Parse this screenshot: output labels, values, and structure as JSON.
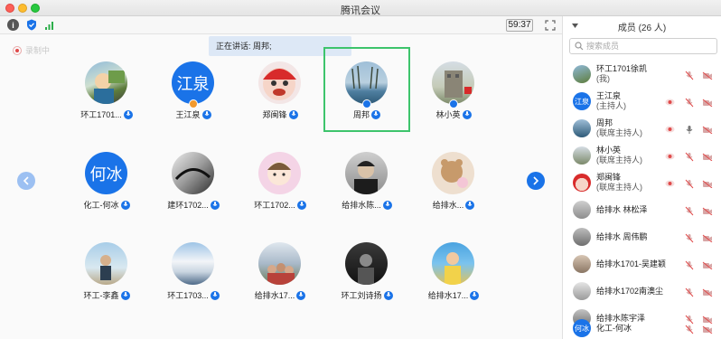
{
  "window": {
    "title": "腾讯会议"
  },
  "toolbar": {
    "timer": "59:37"
  },
  "main": {
    "speaking": "正在讲话: 周邦;",
    "recording": "录制中",
    "tiles": [
      {
        "name": "环工1701...",
        "avatar": "photo-cartoon"
      },
      {
        "name": "王江泉",
        "avatar_text": "江泉",
        "badge": "host"
      },
      {
        "name": "郑闽锋",
        "avatar": "photo-red"
      },
      {
        "name": "周邦",
        "avatar": "photo-lake",
        "badge": "cohost"
      },
      {
        "name": "林小英",
        "avatar": "photo-building",
        "badge": "cohost"
      },
      {
        "name": "化工-何冰",
        "avatar_text": "何冰"
      },
      {
        "name": "建环1702...",
        "avatar": "photo-bw"
      },
      {
        "name": "环工1702...",
        "avatar": "photo-pink"
      },
      {
        "name": "给排水陈...",
        "avatar": "photo-man"
      },
      {
        "name": "给排水...",
        "avatar": "photo-bear"
      },
      {
        "name": "环工-李鑫",
        "avatar": "photo-person-sky"
      },
      {
        "name": "环工1703...",
        "avatar": "photo-snow"
      },
      {
        "name": "给排水17...",
        "avatar": "photo-group"
      },
      {
        "name": "环工刘诗扬",
        "avatar": "photo-dark"
      },
      {
        "name": "给排水17...",
        "avatar": "photo-boy"
      }
    ]
  },
  "panel": {
    "title": "成员 (26 人)",
    "search_placeholder": "搜索成员",
    "members": [
      {
        "name": "环工1701徐凯",
        "role": "(我)",
        "avatar": "photo-cartoon"
      },
      {
        "name": "王江泉",
        "role": "(主持人)",
        "avatar_text": "江泉",
        "share": true
      },
      {
        "name": "周邦",
        "role": "(联席主持人)",
        "avatar": "photo-lake",
        "share": true,
        "mic_on": true
      },
      {
        "name": "林小英",
        "role": "(联席主持人)",
        "avatar": "photo-building",
        "share": true
      },
      {
        "name": "郑闽锋",
        "role": "(联席主持人)",
        "avatar": "photo-red",
        "share": true
      },
      {
        "name": "给排水 林松泽",
        "avatar": "photo-gray"
      },
      {
        "name": "给排水 周伟鹏",
        "avatar": "photo-gray"
      },
      {
        "name": "给排水1701-吴建颖",
        "avatar": "photo-gray"
      },
      {
        "name": "给排水1702南澳尘",
        "avatar": "photo-gray"
      },
      {
        "name": "给排水陈宇泽",
        "avatar": "photo-gray"
      },
      {
        "name": "化工-何冰",
        "avatar_text": "何冰"
      }
    ]
  },
  "colors": {
    "accent": "#1a73e8",
    "highlight": "#3dc46c",
    "muted_red": "#e04a4a"
  }
}
